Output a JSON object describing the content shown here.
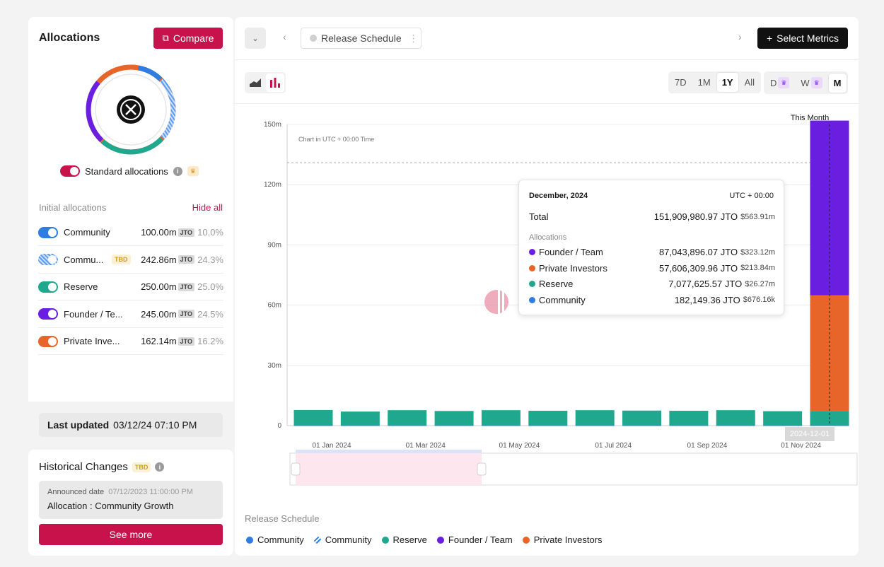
{
  "allocations_panel": {
    "title": "Allocations",
    "compare_label": "Compare",
    "standard_allocations_label": "Standard allocations",
    "initial_allocations_label": "Initial allocations",
    "hide_all_label": "Hide all",
    "items": [
      {
        "name": "Community",
        "tag": "",
        "amount": "100.00m",
        "unit": "JTO",
        "pct": "10.0%",
        "color": "#2f7de1"
      },
      {
        "name": "Commu...",
        "tag": "TBD",
        "amount": "242.86m",
        "unit": "JTO",
        "pct": "24.3%",
        "color": "#2f7de1"
      },
      {
        "name": "Reserve",
        "tag": "",
        "amount": "250.00m",
        "unit": "JTO",
        "pct": "25.0%",
        "color": "#1fa88d"
      },
      {
        "name": "Founder / Te...",
        "tag": "",
        "amount": "245.00m",
        "unit": "JTO",
        "pct": "24.5%",
        "color": "#6a1fe0"
      },
      {
        "name": "Private Inve...",
        "tag": "",
        "amount": "162.14m",
        "unit": "JTO",
        "pct": "16.2%",
        "color": "#e8652a"
      }
    ],
    "last_updated_label": "Last updated",
    "last_updated_value": "03/12/24 07:10 PM"
  },
  "historical": {
    "title": "Historical Changes",
    "tag": "TBD",
    "announced_label": "Announced date",
    "announced_value": "07/12/2023 11:00:00 PM",
    "allocation_text": "Allocation : Community Growth",
    "see_more_label": "See more"
  },
  "toolbar": {
    "dataset_label": "Release Schedule",
    "select_metrics_label": "Select Metrics",
    "ranges": [
      "7D",
      "1M",
      "1Y",
      "All"
    ],
    "active_range": "1Y",
    "intervals": [
      "D",
      "W",
      "M"
    ],
    "active_interval": "M"
  },
  "chart_header": {
    "note": "Chart in UTC + 00:00 Time",
    "this_month_label": "This Month",
    "hover_date_label": "2024-12-01"
  },
  "tooltip": {
    "date": "December, 2024",
    "tz": "UTC + 00:00",
    "total_label": "Total",
    "total_value": "151,909,980.97 JTO",
    "total_usd": "$563.91m",
    "section_label": "Allocations",
    "rows": [
      {
        "name": "Founder / Team",
        "value": "87,043,896.07 JTO",
        "usd": "$323.12m",
        "color": "#6a1fe0"
      },
      {
        "name": "Private Investors",
        "value": "57,606,309.96 JTO",
        "usd": "$213.84m",
        "color": "#e8652a"
      },
      {
        "name": "Reserve",
        "value": "7,077,625.57 JTO",
        "usd": "$26.27m",
        "color": "#1fa88d"
      },
      {
        "name": "Community",
        "value": "182,149.36 JTO",
        "usd": "$676.16k",
        "color": "#2f7de1"
      }
    ]
  },
  "legend": {
    "title": "Release Schedule",
    "items": [
      {
        "name": "Community",
        "color": "#2f7de1",
        "style": "dot"
      },
      {
        "name": "Community",
        "color": "#2f7de1",
        "style": "hatch"
      },
      {
        "name": "Reserve",
        "color": "#1fa88d",
        "style": "dot"
      },
      {
        "name": "Founder / Team",
        "color": "#6a1fe0",
        "style": "dot"
      },
      {
        "name": "Private Investors",
        "color": "#e8652a",
        "style": "dot"
      }
    ]
  },
  "chart_data": {
    "type": "bar",
    "stacked": true,
    "ylim": [
      0,
      150000000
    ],
    "y_ticks": [
      0,
      30000000,
      60000000,
      90000000,
      120000000,
      150000000
    ],
    "y_tick_labels": [
      "0",
      "30m",
      "60m",
      "90m",
      "120m",
      "150m"
    ],
    "x_tick_labels": [
      "01 Jan 2024",
      "01 Mar 2024",
      "01 May 2024",
      "01 Jul 2024",
      "01 Sep 2024",
      "01 Nov 2024"
    ],
    "categories": [
      "2024-01",
      "2024-02",
      "2024-03",
      "2024-04",
      "2024-05",
      "2024-06",
      "2024-07",
      "2024-08",
      "2024-09",
      "2024-10",
      "2024-11",
      "2024-12"
    ],
    "series": [
      {
        "name": "Community",
        "color": "#2f7de1",
        "values": [
          182149,
          182149,
          182149,
          182149,
          182149,
          182149,
          182149,
          182149,
          182149,
          182149,
          182149,
          182149
        ]
      },
      {
        "name": "Reserve",
        "color": "#1fa88d",
        "values": [
          7600000,
          6800000,
          7500000,
          7100000,
          7500000,
          7200000,
          7500000,
          7300000,
          7200000,
          7500000,
          7000000,
          7077626
        ]
      },
      {
        "name": "Private Investors",
        "color": "#e8652a",
        "values": [
          0,
          0,
          0,
          0,
          0,
          0,
          0,
          0,
          0,
          0,
          0,
          57606310
        ]
      },
      {
        "name": "Founder / Team",
        "color": "#6a1fe0",
        "values": [
          0,
          0,
          0,
          0,
          0,
          0,
          0,
          0,
          0,
          0,
          0,
          87043896
        ]
      }
    ],
    "reference_line": 131000000,
    "grid": true
  }
}
